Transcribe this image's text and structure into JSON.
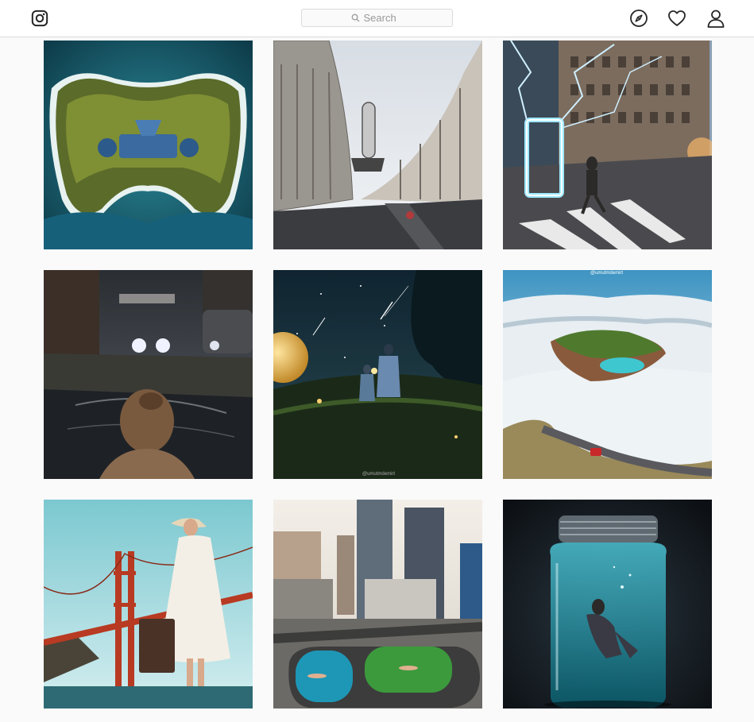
{
  "header": {
    "search": {
      "placeholder": "Search"
    }
  },
  "icons": {
    "logo": "instagram-icon",
    "explore": "compass-icon",
    "activity": "heart-icon",
    "profile": "user-icon"
  },
  "watermarks": {
    "post6": "@umutmdemirt",
    "post5": "@umutmdemirt"
  },
  "colors": {
    "topbar_bg": "#ffffff",
    "page_bg": "#fafafa",
    "border": "#dbdbdb",
    "icon": "#262626"
  }
}
